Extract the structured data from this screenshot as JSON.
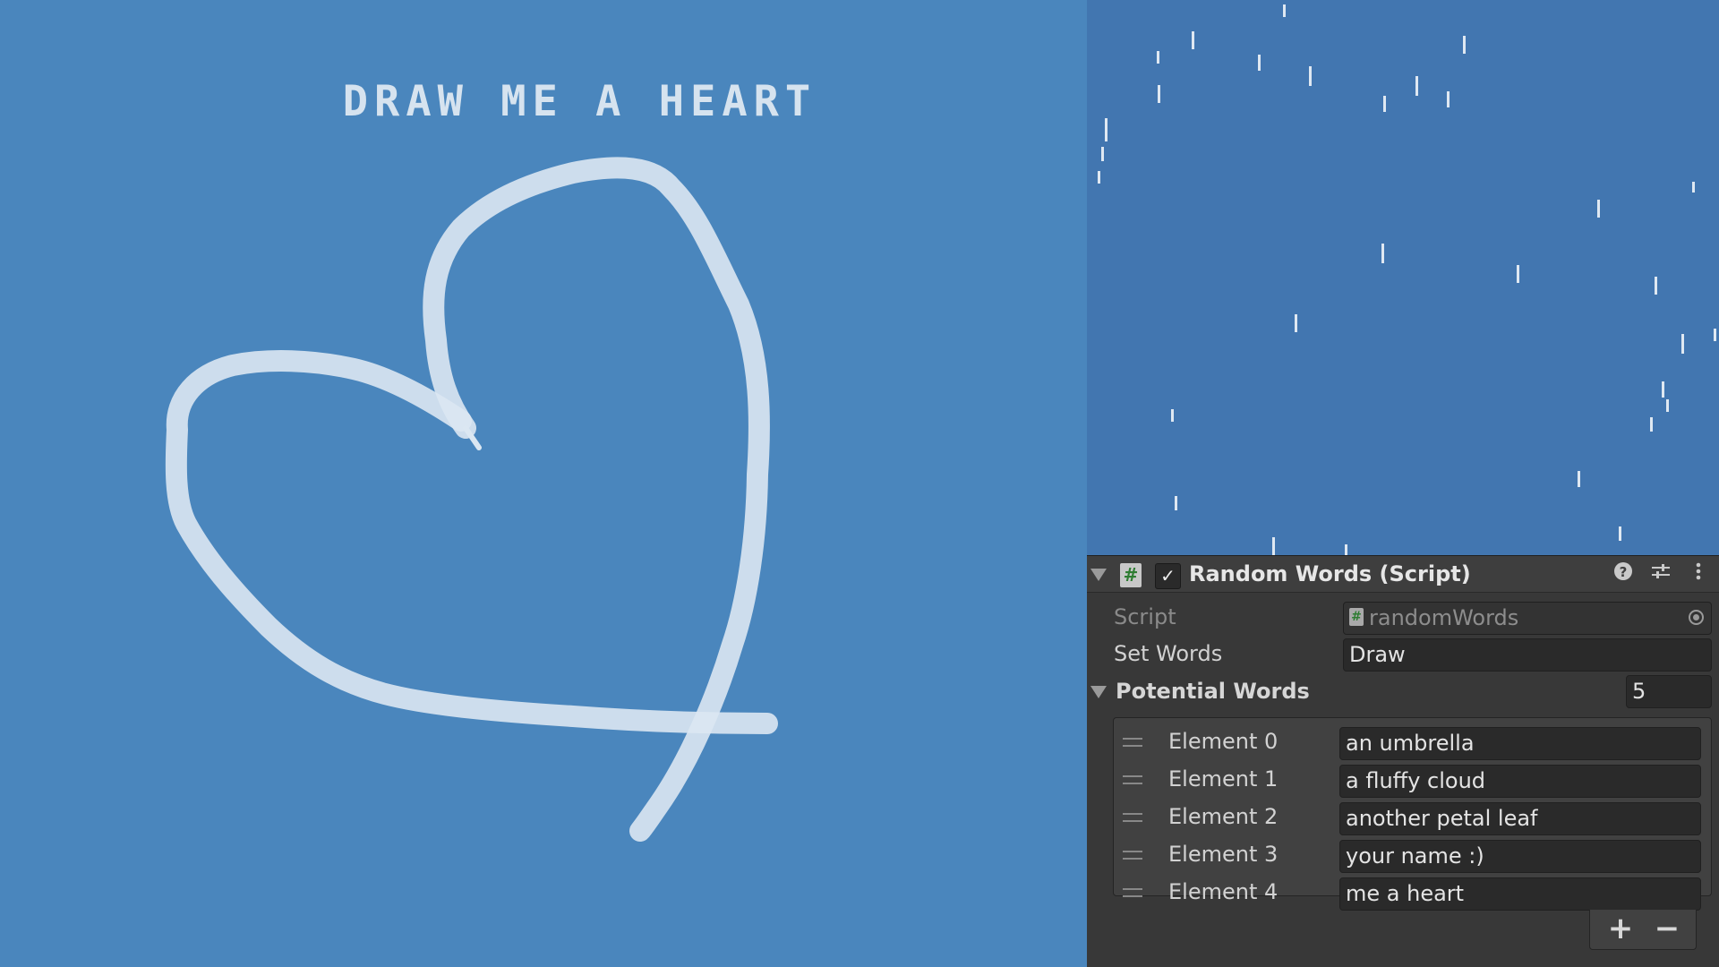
{
  "game": {
    "title": "DRAW ME A HEART",
    "stroke_color": "#dbe7f2",
    "background_color": "#4a86bd"
  },
  "scene": {
    "background_color": "#4276b0"
  },
  "inspector": {
    "component": {
      "title": "Random Words (Script)",
      "enabled": true,
      "icons": [
        "help-icon",
        "preset-icon",
        "more-icon"
      ]
    },
    "script": {
      "label": "Script",
      "value": "randomWords"
    },
    "set_words": {
      "label": "Set Words",
      "value": "Draw"
    },
    "potential_words": {
      "label": "Potential Words",
      "size": "5",
      "elements": [
        {
          "label": "Element 0",
          "value": "an umbrella"
        },
        {
          "label": "Element 1",
          "value": "a fluffy cloud"
        },
        {
          "label": "Element 2",
          "value": "another petal leaf"
        },
        {
          "label": "Element 3",
          "value": "your name :)"
        },
        {
          "label": "Element 4",
          "value": "me a heart"
        }
      ],
      "add_label": "+",
      "remove_label": "−"
    }
  }
}
